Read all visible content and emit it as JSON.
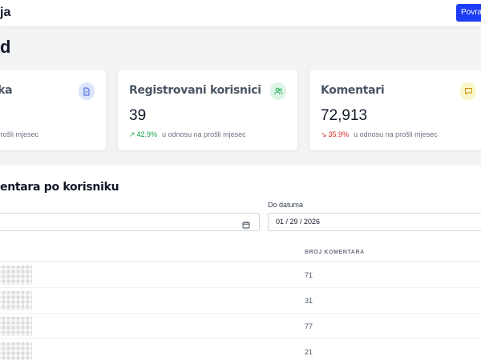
{
  "header": {
    "brand": "ja",
    "back_button": "Povra"
  },
  "page": {
    "title": "d"
  },
  "cards": [
    {
      "title": "aka",
      "value": "",
      "trend": "",
      "trend_dir": "none",
      "note": "u prošli mjesec",
      "icon": "document-icon",
      "icon_bg": "#dbe6fb",
      "icon_color": "#3b5bdb"
    },
    {
      "title": "Registrovani korisnici",
      "value": "39",
      "trend": "42.9%",
      "trend_dir": "up",
      "note": "u odnosu na prošli mjesec",
      "icon": "users-icon",
      "icon_bg": "#dcf5e6",
      "icon_color": "#16a34a"
    },
    {
      "title": "Komentari",
      "value": "72,913",
      "trend": "35.9%",
      "trend_dir": "down",
      "note": "u odnosu na prošli mjesec",
      "icon": "comment-icon",
      "icon_bg": "#fbf6c9",
      "icon_color": "#ca8a04"
    }
  ],
  "comments_panel": {
    "title": "entara po korisniku",
    "to_date_label": "Do datuma",
    "to_date_value": "01 / 29 / 2026",
    "from_date_value": "",
    "columns": {
      "count": "BROJ KOMENTARA"
    },
    "rows": [
      {
        "count": "71"
      },
      {
        "count": "31"
      },
      {
        "count": "77"
      },
      {
        "count": "21"
      }
    ]
  },
  "colors": {
    "primary": "#1d3cf5",
    "up": "#16a34a",
    "down": "#dc2626"
  }
}
